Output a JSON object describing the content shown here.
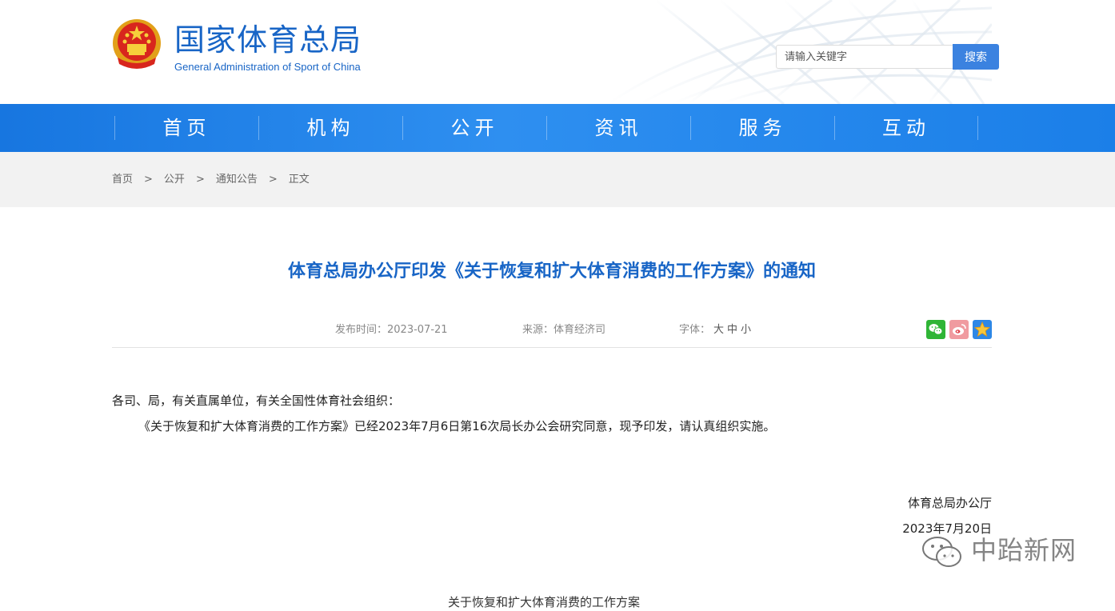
{
  "header": {
    "site_name_cn": "国家体育总局",
    "site_name_en": "General Administration of Sport of China",
    "search": {
      "placeholder": "请输入关键字",
      "button_label": "搜索"
    }
  },
  "nav": {
    "items": [
      {
        "label": "首页"
      },
      {
        "label": "机构"
      },
      {
        "label": "公开"
      },
      {
        "label": "资讯"
      },
      {
        "label": "服务"
      },
      {
        "label": "互动"
      }
    ]
  },
  "breadcrumb": {
    "items": [
      {
        "label": "首页"
      },
      {
        "label": "公开"
      },
      {
        "label": "通知公告"
      },
      {
        "label": "正文"
      }
    ],
    "separator": ">"
  },
  "article": {
    "title": "体育总局办公厅印发《关于恢复和扩大体育消费的工作方案》的通知",
    "meta": {
      "date_label": "发布时间：",
      "date": "2023-07-21",
      "source_label": "来源：",
      "source": "体育经济司",
      "font_label": "字体：",
      "font_large": "大",
      "font_medium": "中",
      "font_small": "小"
    },
    "share_icons": [
      "wechat-icon",
      "weibo-icon",
      "favorite-star-icon"
    ],
    "greeting": "各司、局，有关直属单位，有关全国性体育社会组织：",
    "body": "《关于恢复和扩大体育消费的工作方案》已经2023年7月6日第16次局长办公会研究同意，现予印发，请认真组织实施。",
    "signature": "体育总局办公厅",
    "sign_date": "2023年7月20日",
    "cut_text": "关于恢复和扩大体育消费的工作方案"
  },
  "watermark": {
    "text": "中跆新网",
    "icon": "wechat-logo-icon"
  },
  "colors": {
    "brand_blue": "#1865c6",
    "nav_blue": "#1f80e8",
    "search_button": "#3b82e0",
    "breadcrumb_bg": "#f2f2f2"
  }
}
